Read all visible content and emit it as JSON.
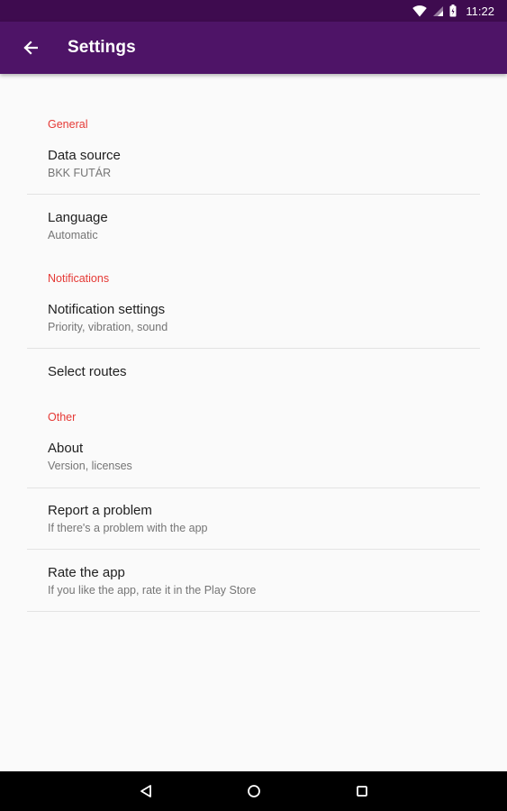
{
  "status_bar": {
    "time": "11:22"
  },
  "app_bar": {
    "title": "Settings",
    "back_icon": "arrow-back-icon"
  },
  "colors": {
    "app_bar": "#4e1467",
    "status_bar": "#3e0b4f",
    "category_text": "#e53935"
  },
  "sections": [
    {
      "label": "General",
      "items": [
        {
          "title": "Data source",
          "summary": "BKK FUTÁR"
        },
        {
          "title": "Language",
          "summary": "Automatic"
        }
      ]
    },
    {
      "label": "Notifications",
      "items": [
        {
          "title": "Notification settings",
          "summary": "Priority, vibration, sound"
        },
        {
          "title": "Select routes"
        }
      ]
    },
    {
      "label": "Other",
      "items": [
        {
          "title": "About",
          "summary": "Version, licenses"
        },
        {
          "title": "Report a problem",
          "summary": "If there's a problem with the app"
        },
        {
          "title": "Rate the app",
          "summary": "If you like the app, rate it in the Play Store"
        }
      ]
    }
  ],
  "nav_bar": {
    "icons": [
      "back-triangle-icon",
      "home-circle-icon",
      "recents-square-icon"
    ]
  }
}
